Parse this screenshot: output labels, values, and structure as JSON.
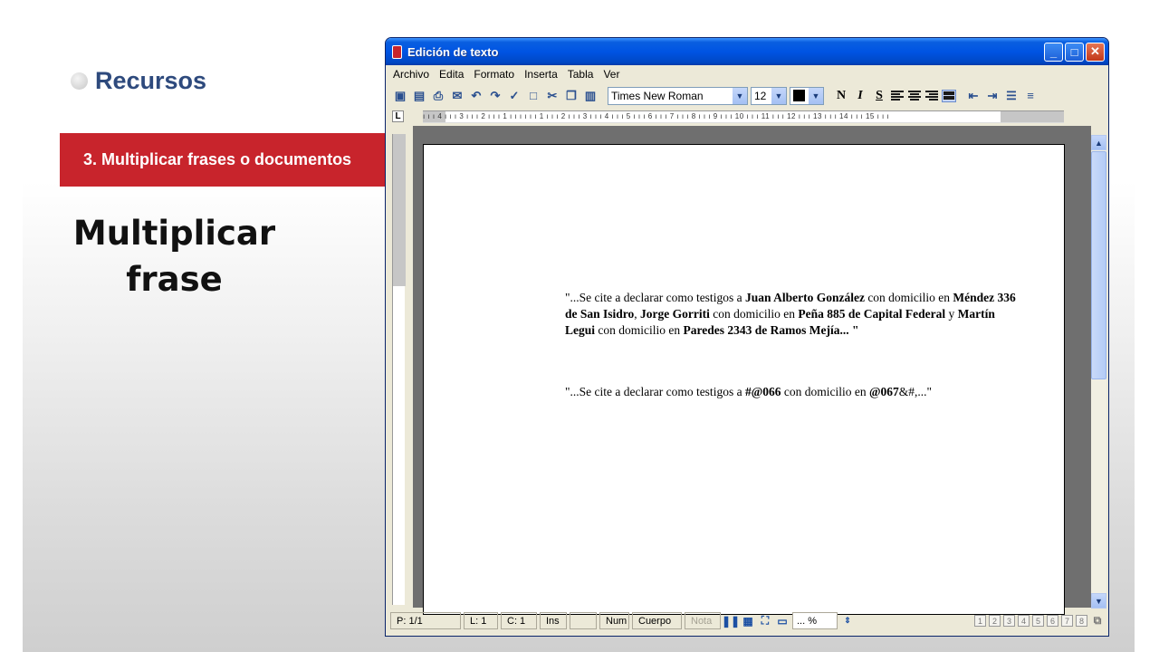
{
  "slide": {
    "section": "Recursos",
    "banner": "3. Multiplicar frases o documentos",
    "title_line1": "Multiplicar",
    "title_line2": "frase"
  },
  "window": {
    "title": "Edición de texto",
    "minimize": "_",
    "maximize": "□",
    "close": "✕"
  },
  "menu": {
    "archivo": "Archivo",
    "edita": "Edita",
    "formato": "Formato",
    "inserta": "Inserta",
    "tabla": "Tabla",
    "ver": "Ver"
  },
  "toolbar": {
    "font": "Times New Roman",
    "size": "12",
    "bold": "N",
    "italic": "I",
    "underline": "S"
  },
  "ruler": {
    "corner": "L",
    "ticks": "ı ı ı 4 ı ı ı 3 ı ı ı 2 ı ı ı 1 ı ı ı ı ı ı 1 ı ı ı 2 ı ı ı 3 ı ı ı 4 ı ı ı 5 ı ı ı 6 ı ı ı 7 ı ı ı 8 ı ı ı 9 ı ı ı 10 ı ı ı 11 ı ı ı 12 ı ı ı 13 ı ı ı 14 ı ı ı 15 ı ı ı"
  },
  "document": {
    "p1": {
      "t1": " \"...Se cite a declarar como testigos a ",
      "b1": "Juan Alberto González",
      "t2": " con domicilio en ",
      "b2": "Méndez 336 de San Isidro",
      "t3": ", ",
      "b3": "Jorge Gorriti",
      "t4": " con domicilio en ",
      "b4": "Peña 885 de Capital Federal",
      "t5": " y ",
      "b5": "Martín Legui",
      "t6": " con domicilio en ",
      "b6": "Paredes 2343 de Ramos Mejía... \""
    },
    "p2": {
      "t1": "\"...Se cite a declarar como testigos a ",
      "b1": "#@066",
      "t2": " con domicilio en ",
      "b2": "@067",
      "t3": "&#,...\""
    }
  },
  "statusbar": {
    "page": "P: 1/1",
    "line": "L: 1",
    "col": "C: 1",
    "ins": "Ins",
    "num": "Num",
    "cuerpo": "Cuerpo",
    "nota": "Nota",
    "zoom": "... %",
    "pages": [
      "1",
      "2",
      "3",
      "4",
      "5",
      "6",
      "7",
      "8"
    ]
  },
  "colors": {
    "banner": "#c8242c",
    "section": "#2e4a7d",
    "titlebar": "#0054e3"
  }
}
